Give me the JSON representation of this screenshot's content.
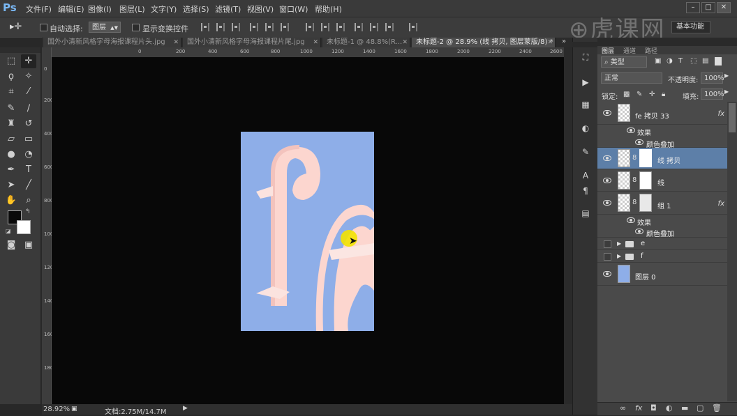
{
  "app": {
    "logo": "Ps",
    "accent": "#7ab8f5"
  },
  "menu": [
    "文件(F)",
    "编辑(E)",
    "图像(I)",
    "图层(L)",
    "文字(Y)",
    "选择(S)",
    "滤镜(T)",
    "视图(V)",
    "窗口(W)",
    "帮助(H)"
  ],
  "options": {
    "auto_select_label": "自动选择:",
    "auto_select_value": "图层",
    "show_transform_label": "显示变换控件",
    "workspace": "基本功能"
  },
  "tabs": [
    {
      "label": "国外小清新风格字母海报课程片头.jpg"
    },
    {
      "label": "国外小清新风格字母海报课程片尾.jpg"
    },
    {
      "label": "未标题-1 @ 48.8%(R..."
    },
    {
      "label": "未标题-2 @ 28.9% (线 拷贝, 图层蒙版/8) *"
    }
  ],
  "ruler_h": [
    "0",
    "200",
    "400",
    "600",
    "800",
    "1000",
    "1200",
    "1400",
    "1600",
    "1800",
    "2000",
    "2200",
    "2400",
    "2600",
    "2800",
    "3000",
    "3200"
  ],
  "ruler_v": [
    "0",
    "200",
    "400",
    "600",
    "800",
    "1000",
    "1200",
    "1400",
    "1600",
    "1800"
  ],
  "status": {
    "zoom": "28.92%",
    "doc": "文档:2.75M/14.7M"
  },
  "layers_panel": {
    "tabs": [
      "图层",
      "通道",
      "路径"
    ],
    "filter_kind": "类型",
    "blend_mode": "正常",
    "opacity_label": "不透明度:",
    "opacity": "100%",
    "lock_label": "锁定:",
    "fill_label": "填充:",
    "fill": "100%",
    "layers": [
      {
        "name": "fe 拷贝 33",
        "fx": "fx"
      },
      {
        "name": "效果"
      },
      {
        "name": "颜色叠加"
      },
      {
        "name": "线 拷贝"
      },
      {
        "name": "线"
      },
      {
        "name": "组 1",
        "fx": "fx"
      },
      {
        "name": "效果"
      },
      {
        "name": "颜色叠加"
      },
      {
        "name": "e"
      },
      {
        "name": "f"
      },
      {
        "name": "图层 0"
      }
    ]
  },
  "canvas": {
    "bg_color": "#8eaee8",
    "letter_color": "#fcd6cf"
  }
}
